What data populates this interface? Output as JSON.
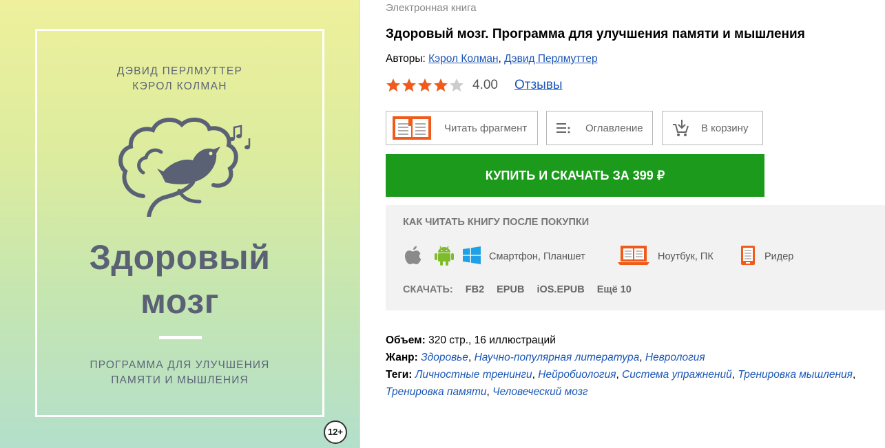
{
  "cover": {
    "author_line1": "ДЭВИД ПЕРЛМУТТЕР",
    "author_line2": "КЭРОЛ КОЛМАН",
    "title_line1": "Здоровый",
    "title_line2": "мозг",
    "subtitle_line1": "ПРОГРАММА ДЛЯ УЛУЧШЕНИЯ",
    "subtitle_line2": "ПАМЯТИ И МЫШЛЕНИЯ",
    "age_rating": "12+",
    "colors": {
      "text": "#5b6175",
      "gradient_top": "#eef09c",
      "gradient_bottom": "#b3dfcb"
    }
  },
  "product": {
    "type_label": "Электронная книга",
    "title": "Здоровый мозг. Программа для улучшения памяти и мышления",
    "authors_label": "Авторы: ",
    "authors": [
      "Кэрол Колман",
      "Дэвид Перлмуттер"
    ],
    "authors_separator": ", ",
    "rating_value": "4.00",
    "rating_stars": 4,
    "rating_max": 5,
    "reviews_label": "Отзывы"
  },
  "actions": {
    "read_fragment": "Читать фрагмент",
    "contents": "Оглавление",
    "to_cart": "В корзину",
    "buy": "КУПИТЬ И СКАЧАТЬ ЗА 399 ₽"
  },
  "how_to_read": {
    "title": "КАК ЧИТАТЬ КНИГУ ПОСЛЕ ПОКУПКИ",
    "devices": {
      "mobile": "Смартфон, Планшет",
      "laptop": "Ноутбук, ПК",
      "reader": "Ридер"
    },
    "download_label": "СКАЧАТЬ:",
    "formats": [
      "FB2",
      "EPUB",
      "iOS.EPUB",
      "Ещё 10"
    ]
  },
  "details": {
    "volume_label": "Объем:",
    "volume_value": " 320 стр., 16 иллюстраций",
    "genre_label": "Жанр:",
    "genres": [
      "Здоровье",
      "Научно-популярная литература",
      "Неврология"
    ],
    "tags_label": "Теги:",
    "tags": [
      "Личностные тренинги",
      "Нейробиология",
      "Система упражнений",
      "Тренировка мышления",
      "Тренировка памяти",
      "Человеческий мозг"
    ]
  },
  "colors": {
    "accent_green": "#1b9a1b",
    "link": "#1a56b6",
    "star": "#f05a1a",
    "star_empty": "#cccccc",
    "orange_icon": "#f05a1a"
  },
  "icons": {
    "read_fragment": "open-book-icon",
    "contents": "list-icon",
    "to_cart": "cart-icon",
    "apple": "apple-icon",
    "android": "android-icon",
    "windows": "windows-icon",
    "laptop": "laptop-icon",
    "reader": "ereader-icon"
  }
}
